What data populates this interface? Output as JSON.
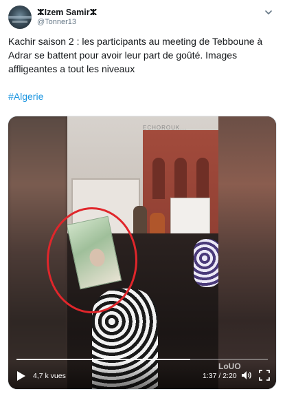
{
  "tweet": {
    "author_name": "ⵣIzem Samirⵣ",
    "author_handle": "@Tonner13",
    "text": "Kachir saison 2 : les participants au meeting de Tebboune à Adrar se battent pour avoir leur part de goûté. Images affligeantes a tout les niveaux",
    "hashtag": "#Algerie"
  },
  "video": {
    "views": "4,7 k vues",
    "time": "1:37 / 2:20",
    "progress": 0.69,
    "watermark": "ECHOROUK...",
    "corner_logo": "LoUO"
  },
  "colors": {
    "hashtag": "#1b95e0",
    "highlight_circle": "#e0262b"
  },
  "icons": [
    "chevron-down-icon",
    "play-icon",
    "volume-icon",
    "fullscreen-icon"
  ]
}
